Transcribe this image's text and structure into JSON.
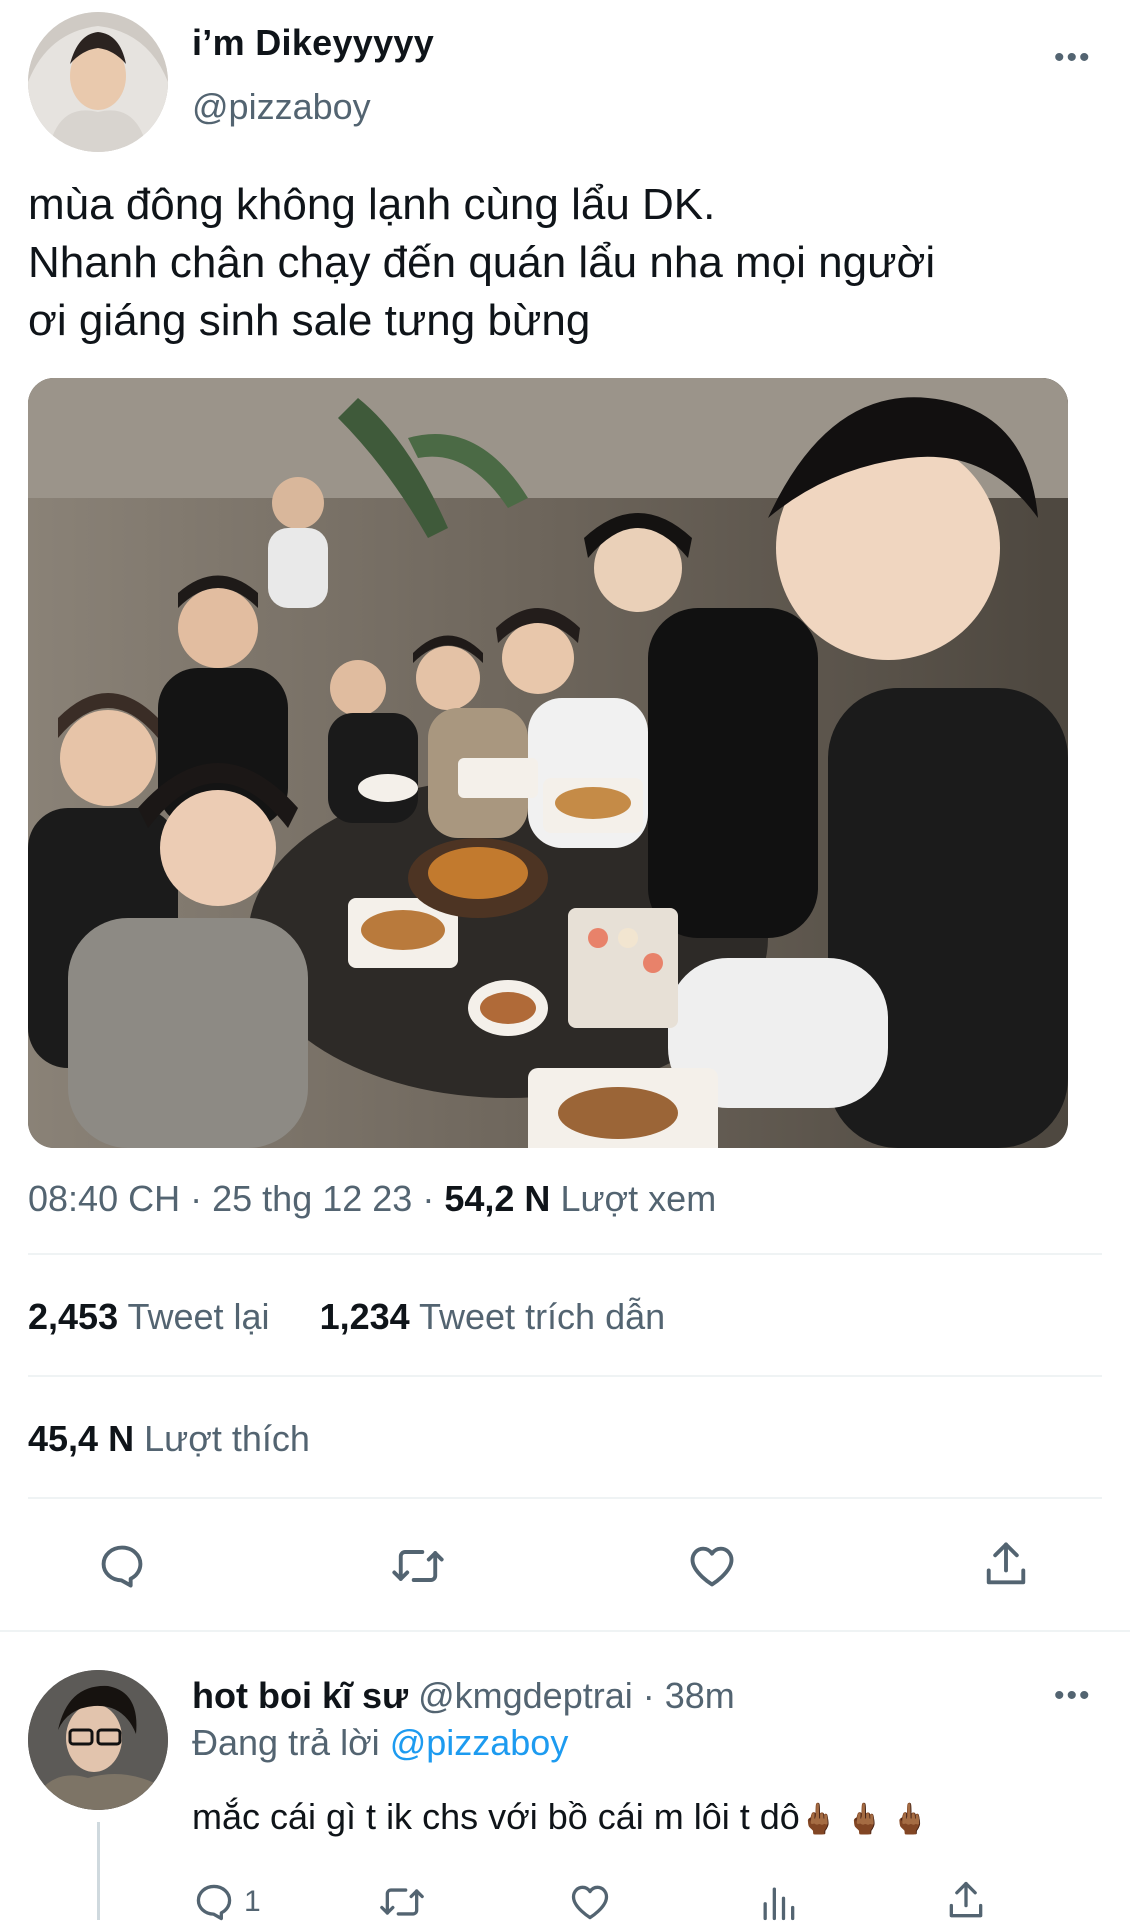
{
  "tweet": {
    "author_name": "i’m Dikeyyyyy",
    "author_handle": "@pizzaboy",
    "text_lines": [
      "mùa đông không lạnh cùng lẩu DK.",
      "Nhanh chân chạy đến quán lẩu nha mọi người",
      "ơi giáng sinh sale tưng bừng"
    ],
    "meta": {
      "time": "08:40 CH",
      "sep1": "·",
      "date": "25 thg 12 23",
      "sep2": "·",
      "views_count": "54,2 N",
      "views_label": "Lượt xem"
    },
    "stats": {
      "retweets_count": "2,453",
      "retweets_label": "Tweet lại",
      "quotes_count": "1,234",
      "quotes_label": "Tweet trích dẫn",
      "likes_count": "45,4 N",
      "likes_label": "Lượt thích"
    },
    "actions": [
      "reply-icon",
      "retweet-icon",
      "like-icon",
      "share-icon"
    ]
  },
  "reply": {
    "author_name": "hot boi kĩ sư",
    "author_handle": "@kmgdeptrai",
    "sep": "·",
    "time": "38m",
    "replying_prefix": "Đang trả lời",
    "replying_to": "@pizzaboy",
    "text": "mắc cái gì t ik chs với bồ cái m lôi t dô",
    "emoji": "🖕🏾 🖕🏾 🖕🏾",
    "reply_count": "1"
  },
  "colors": {
    "text": "#0f1419",
    "muted": "#536471",
    "link": "#1d9bf0",
    "divider": "#eff3f4"
  }
}
